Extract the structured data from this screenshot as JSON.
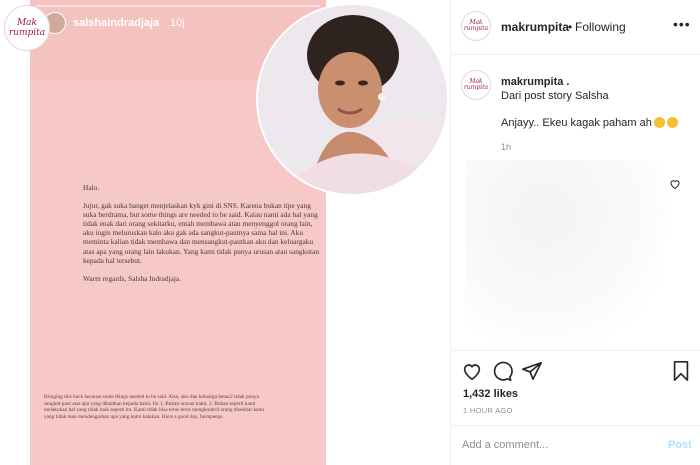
{
  "story": {
    "username": "salshaindradjaja",
    "time": "10j",
    "logo_line1": "Mak",
    "logo_line2": "rumpita",
    "letter": [
      "Halo.",
      "Jujur, gak suka banget menjelaskan kyk gini di SNS. Karena bukan tipe yang suka berdrama, but some things are needed to be said. Kalau nanti ada hal yang tidak enak dari orang sekitarku, entah membawa atau menyenggol orang lain, aku ingin meluruskan kalo aku gak ada sangkut-pautnya sama hal ini. Aku meminta kalian tidak membawa dan mensangkut-pautkan aku dan keluargaku atas apa yang orang lain lakukan. Yang kami tidak punya urusan atau sangkutan kepada hal tersebut.",
      "Warm regards, Salsha Indradjaja."
    ],
    "footnote": "Bringing this back because some things needed to be said. Also, aku dan keluarga benar2 tidak punya sangkut paut atas apa yang dikaitkan kepada kami. Itu 1. Bukan urusan kami, 2. Bukan seperti kami melakukan hal yang tidak baik seperti itu. Kami tidak bisa terus terus mengkontrol orang disekitar kami yang tidak mau mendengarkan apa yang kami katakan. Have a good day, Instapeeps."
  },
  "post": {
    "avatar_line1": "Mak",
    "avatar_line2": "rumpita",
    "username": "makrumpita",
    "separator": "•",
    "follow_status": "Following",
    "more": "•••",
    "caption_username": "makrumpita .",
    "caption_line1": "Dari post story Salsha",
    "caption_line2": "Anjayy.. Ekeu kagak paham ah",
    "caption_time": "1h",
    "likes": "1,432 likes",
    "time_ago": "1 HOUR AGO",
    "comment_placeholder": "Add a comment...",
    "post_label": "Post"
  },
  "colors": {
    "story_pink": "#f7c9c6",
    "brand": "#9b1c3c",
    "post_button_disabled": "#b2dffc"
  }
}
